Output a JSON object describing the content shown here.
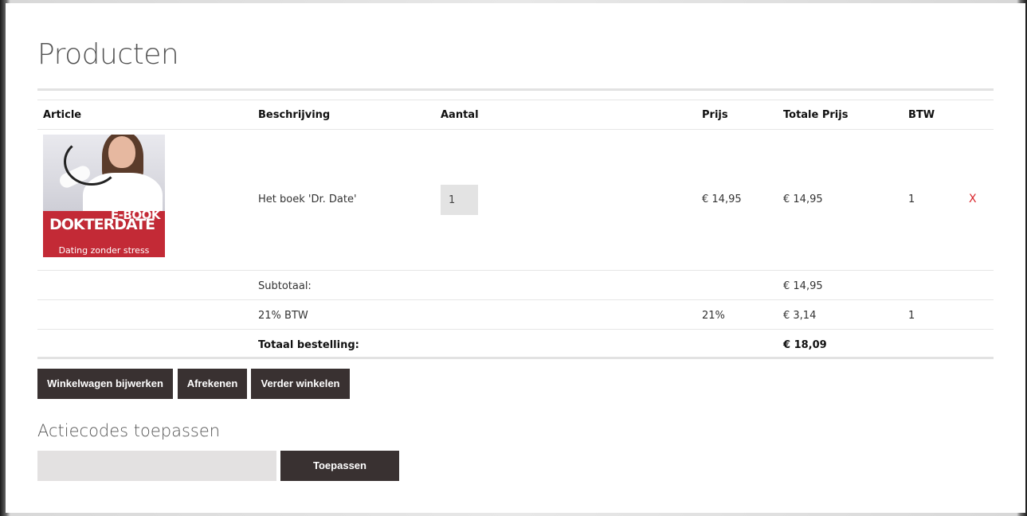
{
  "page": {
    "title": "Producten"
  },
  "table": {
    "headers": {
      "article": "Article",
      "description": "Beschrijving",
      "quantity": "Aantal",
      "price": "Prijs",
      "total_price": "Totale Prijs",
      "vat": "BTW"
    },
    "product": {
      "image_text": {
        "ebook": "E-BOOK",
        "brand": "DOKTERDATE",
        "tagline": "Dating zonder stress"
      },
      "description": "Het boek 'Dr. Date'",
      "quantity": "1",
      "price": "€ 14,95",
      "total_price": "€ 14,95",
      "vat": "1",
      "remove_label": "X"
    },
    "subtotal": {
      "label": "Subtotaal:",
      "value": "€ 14,95"
    },
    "vat_row": {
      "label": "21% BTW",
      "rate": "21%",
      "value": "€ 3,14",
      "vat": "1"
    },
    "order_total": {
      "label": "Totaal bestelling:",
      "value": "€ 18,09"
    }
  },
  "actions": {
    "update_cart": "Winkelwagen bijwerken",
    "checkout": "Afrekenen",
    "continue_shopping": "Verder winkelen"
  },
  "promo": {
    "title": "Actiecodes toepassen",
    "input_value": "",
    "apply_label": "Toepassen"
  },
  "colors": {
    "button_bg": "#393131",
    "remove_red": "#d9262c",
    "product_red": "#c32a36",
    "input_bg": "#e3e3e3"
  }
}
